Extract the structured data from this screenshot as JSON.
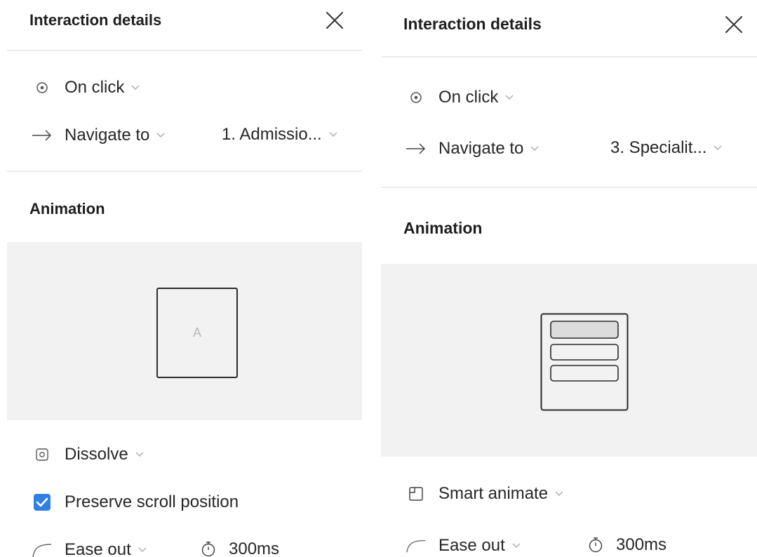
{
  "panels": [
    {
      "title": "Interaction details",
      "trigger": {
        "label": "On click",
        "icon": "target-circle-icon"
      },
      "action": {
        "label": "Navigate to",
        "destination": "1. Admissio...",
        "icon": "arrow-right-icon"
      },
      "animation": {
        "title": "Animation",
        "preview_letter": "A",
        "type": {
          "label": "Dissolve",
          "icon": "dissolve-icon"
        },
        "preserve_scroll": {
          "label": "Preserve scroll position",
          "checked": true
        },
        "easing": {
          "label": "Ease out",
          "icon": "ease-curve-icon"
        },
        "duration": {
          "label": "300ms",
          "icon": "stopwatch-icon"
        }
      }
    },
    {
      "title": "Interaction details",
      "trigger": {
        "label": "On click",
        "icon": "target-circle-icon"
      },
      "action": {
        "label": "Navigate to",
        "destination": "3. Specialit...",
        "icon": "arrow-right-icon"
      },
      "animation": {
        "title": "Animation",
        "type": {
          "label": "Smart animate",
          "icon": "smart-animate-icon"
        },
        "easing": {
          "label": "Ease out",
          "icon": "ease-curve-icon"
        },
        "duration": {
          "label": "300ms",
          "icon": "stopwatch-icon"
        }
      }
    }
  ],
  "colors": {
    "accent": "#2f80e2",
    "divider": "#ececec",
    "preview_bg": "#f2f2f2",
    "text": "#262626",
    "muted": "#b8b8b8"
  }
}
